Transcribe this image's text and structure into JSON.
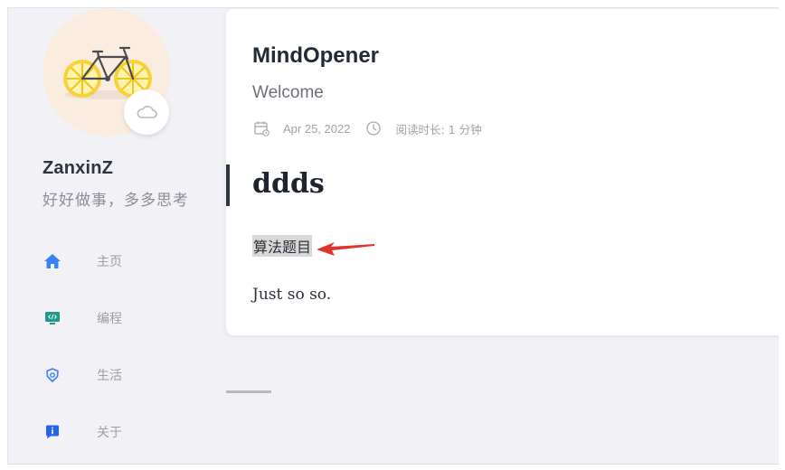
{
  "sidebar": {
    "avatar": "bicycle-lemon-wheels",
    "badge_icon": "cloud-icon",
    "user_name": "ZanxinZ",
    "motto": "好好做事，多多思考",
    "items": [
      {
        "label": "主页",
        "icon": "home-icon",
        "color": "#3b82f6"
      },
      {
        "label": "编程",
        "icon": "code-monitor-icon",
        "color": "#1f9a8a"
      },
      {
        "label": "生活",
        "icon": "lifebuoy-icon",
        "color": "#3b82f6"
      },
      {
        "label": "关于",
        "icon": "info-icon",
        "color": "#2563eb"
      }
    ]
  },
  "post": {
    "site_title": "MindOpener",
    "site_subtitle": "Welcome",
    "date": "Apr 25, 2022",
    "read_time": "阅读时长: 1 分钟",
    "heading": "ddds",
    "link_text": "算法题目",
    "body": "Just so so."
  },
  "colors": {
    "annotation_arrow": "#e0342a",
    "heading_bar": "#2c3645",
    "background": "#f1f1f6"
  }
}
